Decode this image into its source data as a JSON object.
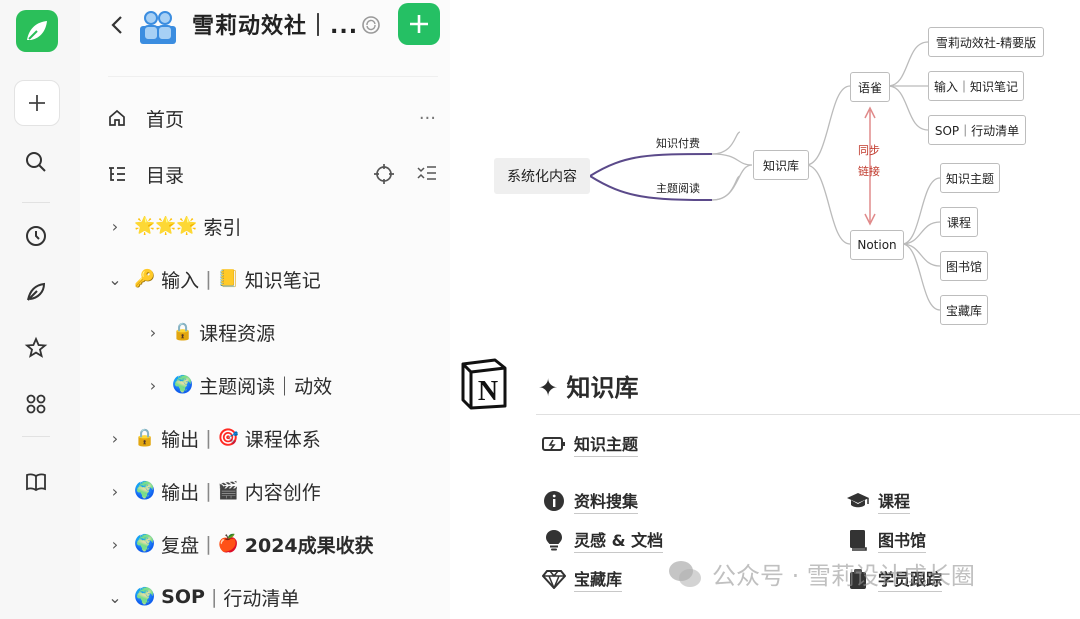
{
  "sidebar": {
    "workspace_title": "雪莉动效社｜...",
    "items": [
      {
        "label": "首页"
      },
      {
        "label": "目录"
      },
      {
        "emoji": "🌟🌟🌟",
        "label": "索引"
      },
      {
        "emoji": "🔑",
        "prefix": "输入",
        "emoji2": "📒",
        "label": "知识笔记"
      },
      {
        "emoji": "🔒",
        "label": "课程资源"
      },
      {
        "emoji": "🌍",
        "label": "主题阅读｜动效"
      },
      {
        "emoji": "🔒",
        "prefix": "输出",
        "emoji2": "🎯",
        "label": "课程体系"
      },
      {
        "emoji": "🌍",
        "prefix": "输出",
        "emoji2": "🎬",
        "label": "内容创作"
      },
      {
        "emoji": "🌍",
        "prefix": "复盘",
        "emoji2": "🍎",
        "label": "2024成果收获"
      },
      {
        "emoji": "🌍",
        "prefix": "SOP",
        "label": "行动清单"
      }
    ],
    "separator": "|"
  },
  "mindmap": {
    "root": "系统化内容",
    "edge_top": "知识付费",
    "edge_bottom": "主题阅读",
    "hub": "知识库",
    "branch_a": "语雀",
    "branch_b": "Notion",
    "sync_1": "同步",
    "sync_2": "链接",
    "a_children": [
      "雪莉动效社-精要版",
      "输入｜知识笔记",
      "SOP｜行动清单"
    ],
    "b_children": [
      "知识主题",
      "课程",
      "图书馆",
      "宝藏库"
    ]
  },
  "notion": {
    "logo_letter": "N",
    "title": "✦ 知识库",
    "items": [
      {
        "label": "知识主题",
        "icon": "battery-icon"
      },
      {
        "label": "资料搜集",
        "icon": "info-icon"
      },
      {
        "label": "课程",
        "icon": "graduation-cap-icon"
      },
      {
        "label": "灵感 & 文档",
        "icon": "lightbulb-icon"
      },
      {
        "label": "图书馆",
        "icon": "book-icon"
      },
      {
        "label": "宝藏库",
        "icon": "gem-icon"
      },
      {
        "label": "学员跟踪",
        "icon": "clipboard-icon"
      }
    ]
  },
  "watermark": {
    "text": "公众号 · 雪莉设计成长圈"
  },
  "colors": {
    "brand_green": "#25c064",
    "sync_red": "#c0392b",
    "arrow_pink": "#e08a8a",
    "curve_purple": "#5b4a8a"
  }
}
